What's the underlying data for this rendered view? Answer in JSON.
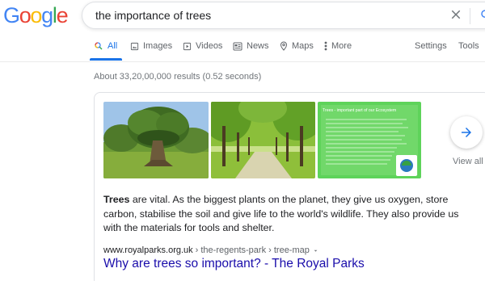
{
  "logo": {
    "letters": [
      "G",
      "o",
      "o",
      "g",
      "l",
      "e"
    ]
  },
  "search": {
    "query": "the importance of trees"
  },
  "tabs": [
    {
      "label": "All",
      "icon": "search-icon",
      "active": true
    },
    {
      "label": "Images",
      "icon": "image-icon"
    },
    {
      "label": "Videos",
      "icon": "play-icon"
    },
    {
      "label": "News",
      "icon": "news-icon"
    },
    {
      "label": "Maps",
      "icon": "map-pin-icon"
    },
    {
      "label": "More",
      "icon": "more-vert-icon"
    }
  ],
  "tools": {
    "settings": "Settings",
    "tools": "Tools"
  },
  "results": {
    "stats": "About 33,20,00,000 results (0.52 seconds)"
  },
  "featured": {
    "images": [
      {
        "alt": "large tree",
        "icon": "tree-image"
      },
      {
        "alt": "avenue of trees",
        "icon": "tree-avenue-image"
      },
      {
        "alt": "infographic",
        "title": "Trees - important part of our Ecosystem",
        "icon": "ecosystem-infographic"
      }
    ],
    "view_all": "View all",
    "snippet_bold": "Trees",
    "snippet_rest": " are vital. As the biggest plants on the planet, they give us oxygen, store carbon, stabilise the soil and give life to the world's wildlife. They also provide us with the materials for tools and shelter.",
    "cite_domain": "www.royalparks.org.uk",
    "cite_path": " › the-regents-park › tree-map",
    "title": "Why are trees so important? - The Royal Parks"
  },
  "colors": {
    "link": "#1a0dab",
    "accent": "#1a73e8",
    "muted": "#70757a"
  }
}
